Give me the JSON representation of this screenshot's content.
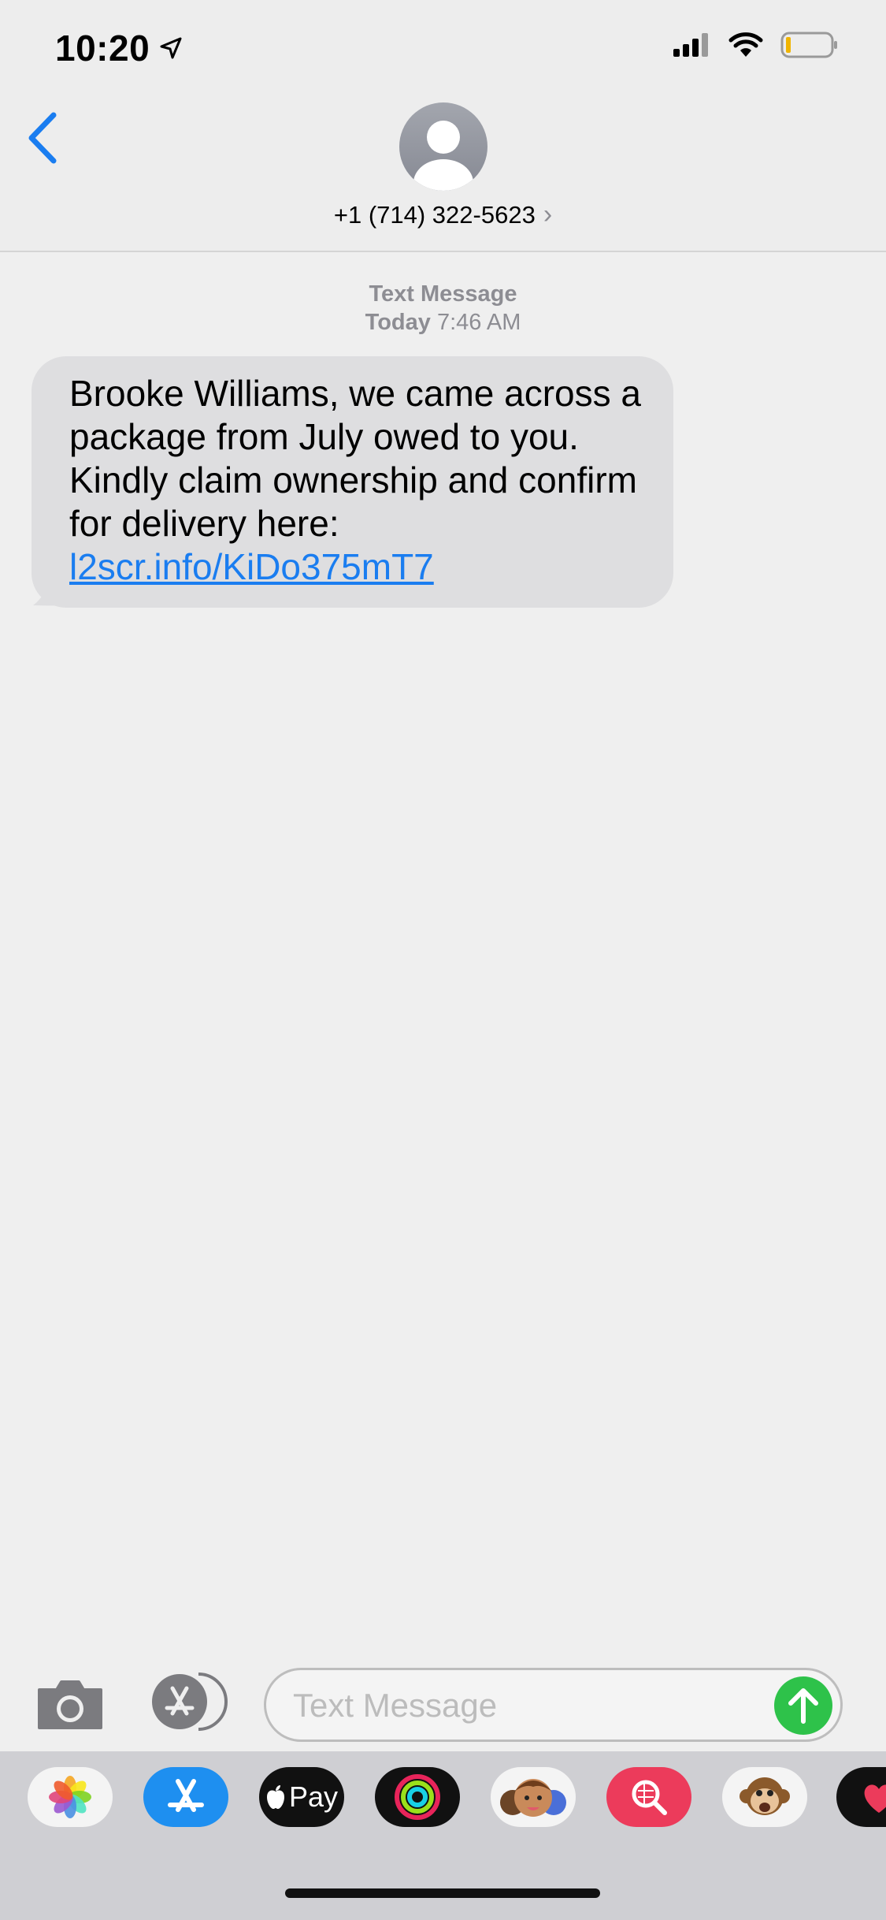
{
  "status_bar": {
    "time": "10:20",
    "icons": [
      "location-arrow-icon",
      "cellular-signal-icon",
      "wifi-icon",
      "battery-icon"
    ]
  },
  "header": {
    "back_icon": "chevron-left-icon",
    "avatar_icon": "person-avatar-icon",
    "contact": "+1 (714) 322-5623",
    "contact_chevron": "›"
  },
  "thread": {
    "meta_label": "Text Message",
    "meta_day": "Today",
    "meta_time": "7:46 AM",
    "message_text": "Brooke Williams, we came across a package from July owed to you. Kindly claim ownership and confirm for delivery here:",
    "message_link": "l2scr.info/KiDo375mT7"
  },
  "composer": {
    "placeholder": "Text Message",
    "camera_icon": "camera-icon",
    "apps_icon": "app-store-icon",
    "send_icon": "send-arrow-up-icon"
  },
  "app_drawer": {
    "items": [
      "photos-icon",
      "app-store-icon",
      "apple-pay-icon",
      "activity-rings-icon",
      "memoji-icon",
      "images-search-icon",
      "animoji-monkey-icon",
      "digital-touch-icon"
    ],
    "apple_pay_label": "Pay"
  },
  "colors": {
    "link": "#1a7df0",
    "bubble": "#dedee0",
    "send": "#2ec24a",
    "accent": "#1a7df0"
  }
}
